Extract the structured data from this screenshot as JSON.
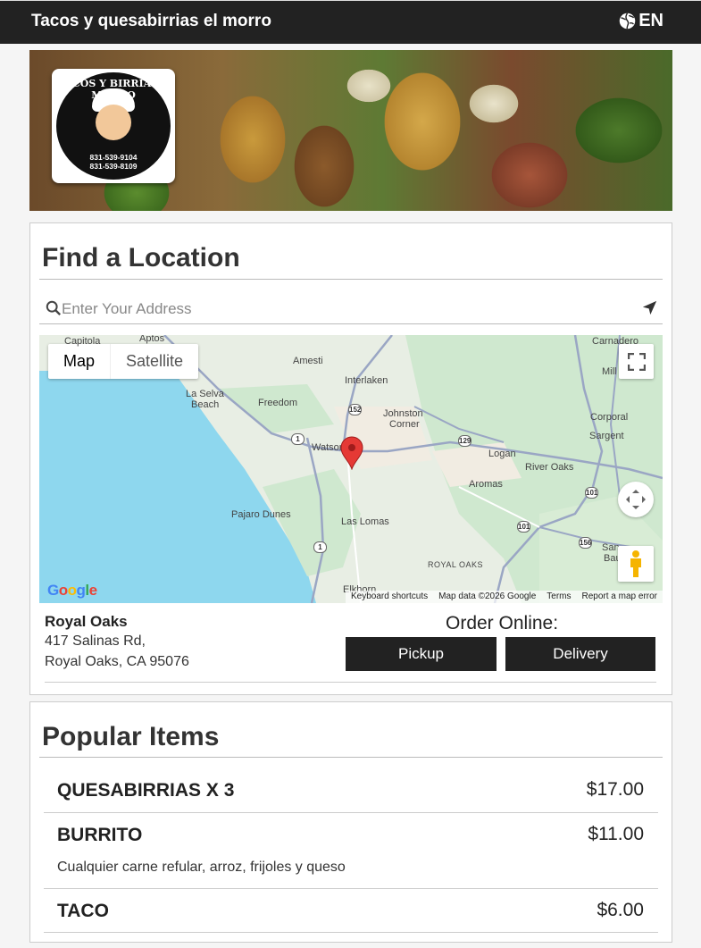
{
  "header": {
    "title": "Tacos y quesabirrias el morro",
    "language": "EN",
    "language_icon": "globe-icon"
  },
  "banner": {
    "logo_text": "TACOS Y BIRRIA EL MORRO",
    "logo_phone_1": "831-539-9104",
    "logo_phone_2": "831-539-8109"
  },
  "find_location": {
    "heading": "Find a Location",
    "search": {
      "placeholder": "Enter Your Address",
      "value": ""
    },
    "map": {
      "type_map": "Map",
      "type_satellite": "Satellite",
      "places": {
        "capitola": "Capitola",
        "aptos": "Aptos",
        "amesti": "Amesti",
        "interlaken": "Interlaken",
        "la_selva": "La Selva",
        "beach": "Beach",
        "freedom": "Freedom",
        "johnston": "Johnston",
        "corner": "Corner",
        "watsonville": "Watsonville",
        "logan": "Logan",
        "river_oaks": "River Oaks",
        "aromas": "Aromas",
        "pajaro_dunes": "Pajaro Dunes",
        "las_lomas": "Las Lomas",
        "royal_oaks": "ROYAL OAKS",
        "elkhorn": "Elkhorn",
        "carnadero": "Carnadero",
        "mill": "Mill",
        "corporal": "Corporal",
        "sargent": "Sargent",
        "san_ba": "San",
        "ba": "Bau"
      },
      "highways": {
        "h152": "152",
        "h1a": "1",
        "h129": "129",
        "h101a": "101",
        "h101b": "101",
        "h156": "156",
        "h1b": "1"
      },
      "google_logo": "Google",
      "attribution": {
        "shortcuts": "Keyboard shortcuts",
        "data": "Map data ©2026 Google",
        "terms": "Terms",
        "report": "Report a map error"
      }
    },
    "location": {
      "name": "Royal Oaks",
      "address_line1": "417 Salinas Rd,",
      "address_line2": "Royal Oaks, CA 95076"
    },
    "order_online": {
      "label": "Order Online:",
      "pickup": "Pickup",
      "delivery": "Delivery"
    }
  },
  "popular": {
    "heading": "Popular Items",
    "items": [
      {
        "name": "QUESABIRRIAS X 3",
        "price": "$17.00",
        "description": ""
      },
      {
        "name": "BURRITO",
        "price": "$11.00",
        "description": "Cualquier carne refular, arroz, frijoles y queso"
      },
      {
        "name": "TACO",
        "price": "$6.00",
        "description": ""
      }
    ]
  },
  "colors": {
    "header_bg": "#222222",
    "button_bg": "#222222",
    "map_water": "#8ed7ee",
    "map_land": "#e8eee4",
    "pin": "#e53935"
  }
}
